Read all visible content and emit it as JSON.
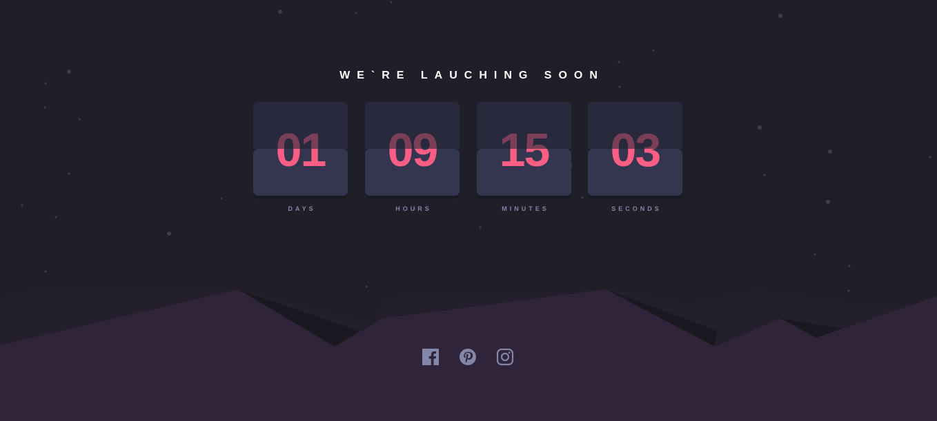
{
  "headline": "WE`RE LAUCHING SOON",
  "countdown": [
    {
      "value": "01",
      "label": "DAYS"
    },
    {
      "value": "09",
      "label": "HOURS"
    },
    {
      "value": "15",
      "label": "MINUTES"
    },
    {
      "value": "03",
      "label": "SECONDS"
    }
  ],
  "social": [
    {
      "icon": "facebook-icon"
    },
    {
      "icon": "pinterest-icon"
    },
    {
      "icon": "instagram-icon"
    }
  ],
  "colors": {
    "background": "#1f1e29",
    "accent": "#fb5e84",
    "card": "#343650",
    "label": "#8486a9",
    "hills": "#2f2439"
  }
}
